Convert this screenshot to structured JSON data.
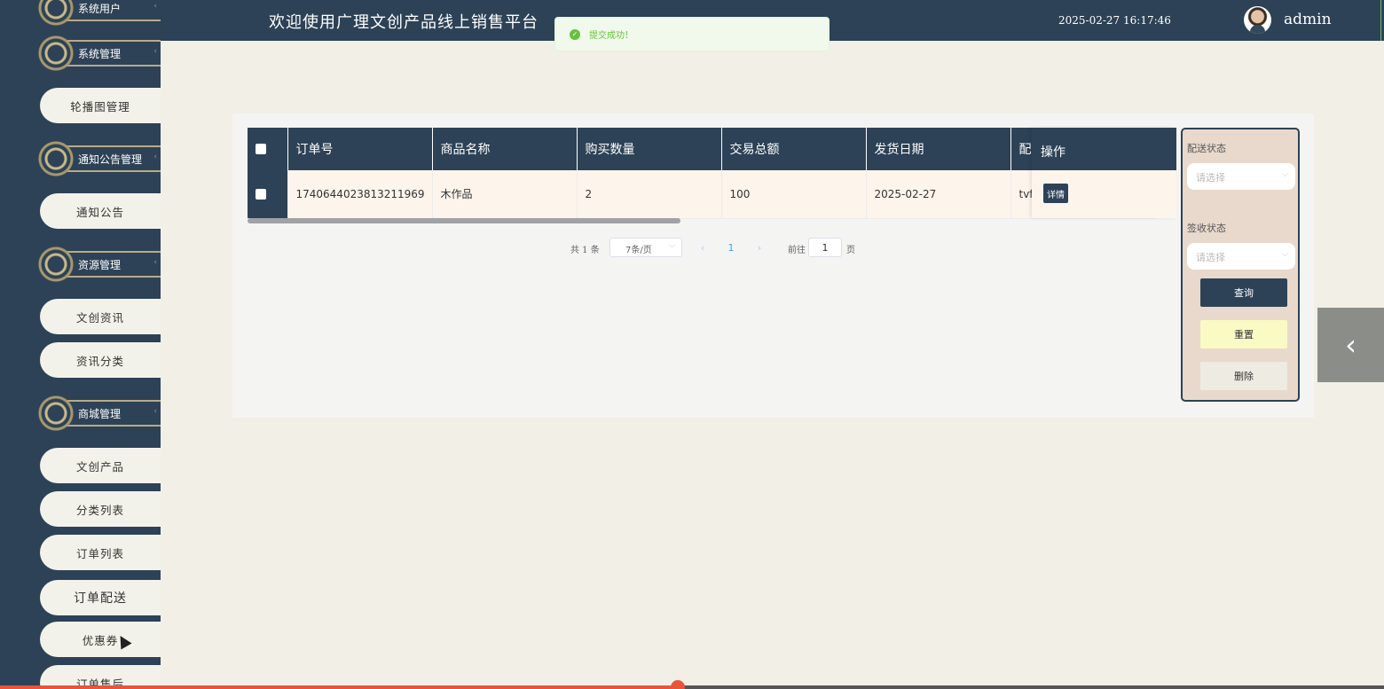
{
  "header": {
    "title": "欢迎使用广理文创产品线上销售平台",
    "datetime": "2025-02-27 16:17:46",
    "username": "admin"
  },
  "toast": {
    "message": "提交成功！",
    "icon": "check-icon"
  },
  "sidebar": {
    "groups": [
      {
        "label": "系统用户"
      },
      {
        "label": "系统管理"
      },
      {
        "label": "通知公告管理"
      },
      {
        "label": "资源管理"
      },
      {
        "label": "商城管理"
      }
    ],
    "items": [
      {
        "label": "轮播图管理"
      },
      {
        "label": "通知公告"
      },
      {
        "label": "文创资讯"
      },
      {
        "label": "资讯分类"
      },
      {
        "label": "文创产品"
      },
      {
        "label": "分类列表"
      },
      {
        "label": "订单列表"
      },
      {
        "label": "订单配送"
      },
      {
        "label": "优惠券"
      },
      {
        "label": "订单售后"
      }
    ]
  },
  "table": {
    "headers": [
      "订单号",
      "商品名称",
      "购买数量",
      "交易总额",
      "发货日期",
      "配",
      "操作"
    ],
    "rows": [
      {
        "order_no": "1740644023813211969",
        "product": "木作品",
        "qty": "2",
        "total": "100",
        "ship_date": "2025-02-27",
        "delivery": "tvf",
        "action": "详情"
      }
    ]
  },
  "pagination": {
    "total": "共 1 条",
    "page_size": "7条/页",
    "current": "1",
    "goto_label": "前往",
    "goto_value": "1",
    "page_unit": "页"
  },
  "search": {
    "delivery_label": "配送状态",
    "delivery_placeholder": "请选择",
    "sign_label": "签收状态",
    "sign_placeholder": "请选择",
    "query_label": "查询",
    "reset_label": "重置",
    "delete_label": "删除"
  },
  "progress": {
    "fraction": 0.49
  }
}
